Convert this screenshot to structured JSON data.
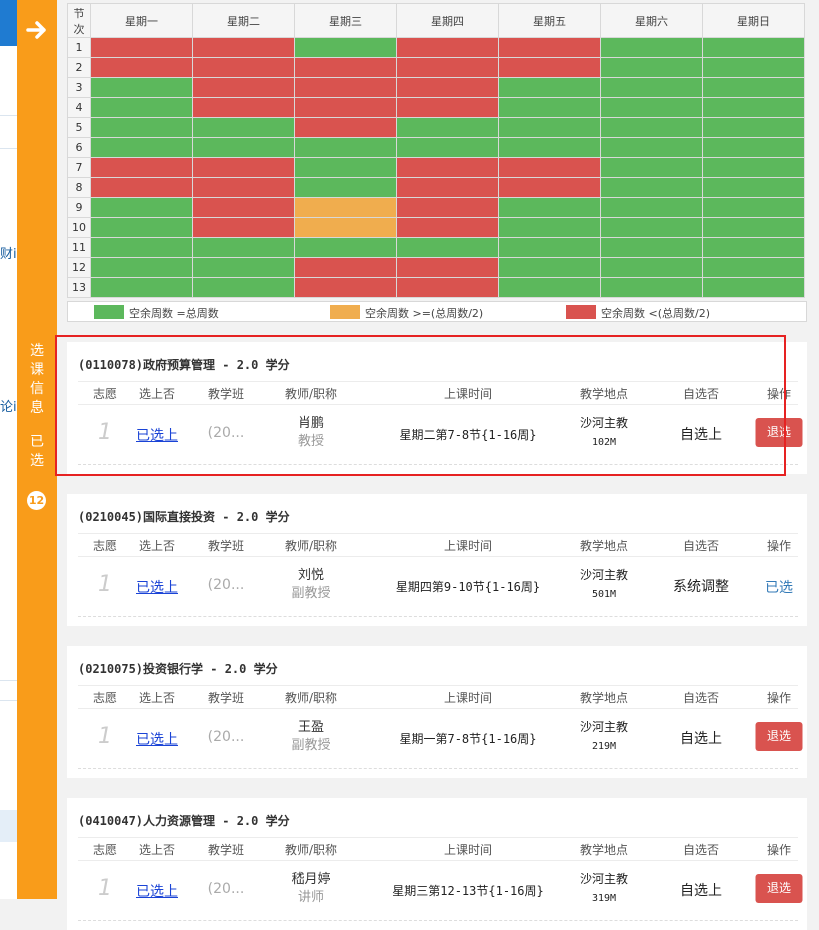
{
  "left_partial": {
    "fin_text": "财i",
    "lun_text": "论i"
  },
  "sidebar": {
    "label_top": [
      "选",
      "课",
      "信",
      "息"
    ],
    "label_bottom": [
      "已",
      "选"
    ],
    "count": "12",
    "arrow": "arrow-right-icon"
  },
  "schedule": {
    "corner": [
      "节",
      "次"
    ],
    "days": [
      "星期一",
      "星期二",
      "星期三",
      "星期四",
      "星期五",
      "星期六",
      "星期日"
    ],
    "periods": [
      "1",
      "2",
      "3",
      "4",
      "5",
      "6",
      "7",
      "8",
      "9",
      "10",
      "11",
      "12",
      "13"
    ],
    "status_grid": [
      [
        "r",
        "r",
        "g",
        "r",
        "r",
        "g",
        "g"
      ],
      [
        "r",
        "r",
        "r",
        "r",
        "r",
        "g",
        "g"
      ],
      [
        "g",
        "r",
        "r",
        "r",
        "g",
        "g",
        "g"
      ],
      [
        "g",
        "r",
        "r",
        "r",
        "g",
        "g",
        "g"
      ],
      [
        "g",
        "g",
        "r",
        "g",
        "g",
        "g",
        "g"
      ],
      [
        "g",
        "g",
        "g",
        "g",
        "g",
        "g",
        "g"
      ],
      [
        "r",
        "r",
        "g",
        "r",
        "r",
        "g",
        "g"
      ],
      [
        "r",
        "r",
        "g",
        "r",
        "r",
        "g",
        "g"
      ],
      [
        "g",
        "r",
        "o",
        "r",
        "g",
        "g",
        "g"
      ],
      [
        "g",
        "r",
        "o",
        "r",
        "g",
        "g",
        "g"
      ],
      [
        "g",
        "g",
        "g",
        "g",
        "g",
        "g",
        "g"
      ],
      [
        "g",
        "g",
        "r",
        "r",
        "g",
        "g",
        "g"
      ],
      [
        "g",
        "g",
        "r",
        "r",
        "g",
        "g",
        "g"
      ]
    ],
    "colors": {
      "g": "#5cb85c",
      "r": "#d9534f",
      "o": "#f0ad4e"
    },
    "legend": [
      {
        "key": "g",
        "text": "空余周数 =总周数"
      },
      {
        "key": "o",
        "text": "空余周数 >=(总周数/2)"
      },
      {
        "key": "r",
        "text": "空余周数 <(总周数/2)"
      }
    ]
  },
  "columns": [
    "志愿",
    "选上否",
    "教学班",
    "教师/职称",
    "上课时间",
    "教学地点",
    "自选否",
    "操作"
  ],
  "courses": [
    {
      "title": "(0110078)政府预算管理 - 2.0 学分",
      "wish": "1",
      "selected": "已选上",
      "class": "(20...",
      "teacher": "肖鹏",
      "rank": "教授",
      "time": "星期二第7-8节{1-16周}",
      "place": "沙河主教",
      "room": "102M",
      "self": "自选上",
      "action": "退选",
      "action_type": "button"
    },
    {
      "title": "(0210045)国际直接投资 - 2.0 学分",
      "wish": "1",
      "selected": "已选上",
      "class": "(20...",
      "teacher": "刘悦",
      "rank": "副教授",
      "time": "星期四第9-10节{1-16周}",
      "place": "沙河主教",
      "room": "501M",
      "self": "系统调整",
      "action": "已选",
      "action_type": "text"
    },
    {
      "title": "(0210075)投资银行学 - 2.0 学分",
      "wish": "1",
      "selected": "已选上",
      "class": "(20...",
      "teacher": "王盈",
      "rank": "副教授",
      "time": "星期一第7-8节{1-16周}",
      "place": "沙河主教",
      "room": "219M",
      "self": "自选上",
      "action": "退选",
      "action_type": "button"
    },
    {
      "title": "(0410047)人力资源管理 - 2.0 学分",
      "wish": "1",
      "selected": "已选上",
      "class": "(20...",
      "teacher": "嵇月婷",
      "rank": "讲师",
      "time": "星期三第12-13节{1-16周}",
      "place": "沙河主教",
      "room": "319M",
      "self": "自选上",
      "action": "退选",
      "action_type": "button"
    }
  ]
}
